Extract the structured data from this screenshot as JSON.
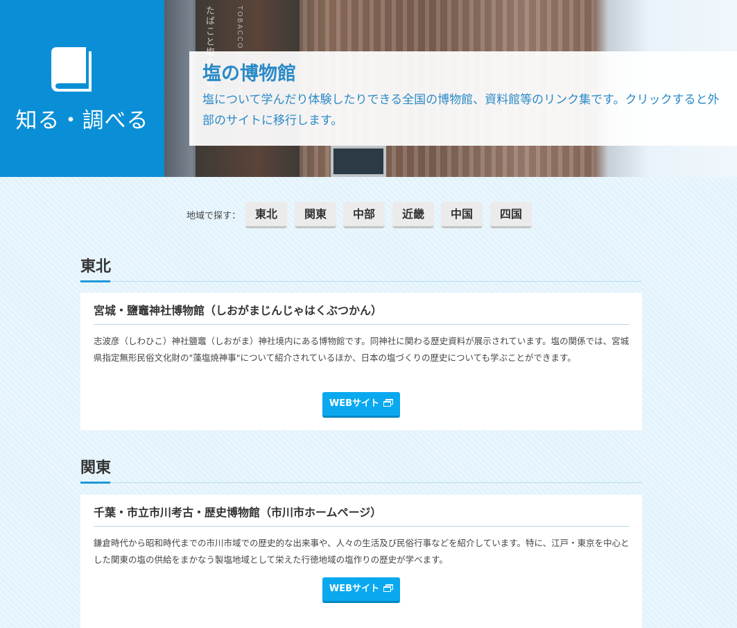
{
  "hero": {
    "badge_title": "知る・調べる",
    "icon": "book-icon",
    "title": "塩の博物館",
    "description": "塩について学んだり体験したりできる全国の博物館、資料館等のリンク集です。クリックすると外部のサイトに移行します。",
    "photo_sign_text": "たばこと塩の博物館",
    "photo_sign_text_en": "TOBACCO & SALT MUSEUM"
  },
  "region_nav": {
    "label": "地域で探す：",
    "buttons": [
      "東北",
      "関東",
      "中部",
      "近畿",
      "中国",
      "四国"
    ]
  },
  "sections": [
    {
      "heading": "東北",
      "card": {
        "title": "宮城・鹽竈神社博物館（しおがまじんじゃはくぶつかん）",
        "description": "志波彦（しわひこ）神社鹽竈（しおがま）神社境内にある博物館です。同神社に関わる歴史資料が展示されています。塩の関係では、宮城県指定無形民俗文化財の\"藻塩焼神事\"について紹介されているほか、日本の塩づくりの歴史についても学ぶことができます。",
        "button_label": "WEBサイト",
        "button_icon": "external-window-icon"
      }
    },
    {
      "heading": "関東",
      "card": {
        "title": "千葉・市立市川考古・歴史博物館（市川市ホームページ）",
        "description": "鎌倉時代から昭和時代までの市川市域での歴史的な出来事や、人々の生活及び民俗行事などを紹介しています。特に、江戸・東京を中心とした関東の塩の供給をまかなう製塩地域として栄えた行徳地域の塩作りの歴史が学べます。",
        "button_label": "WEBサイト",
        "button_icon": "external-window-icon"
      }
    }
  ],
  "colors": {
    "brand_blue": "#0a8fd6",
    "title_blue": "#2a8ac7",
    "button_blue": "#0aa9ef",
    "page_bg": "#e3f3fc"
  }
}
